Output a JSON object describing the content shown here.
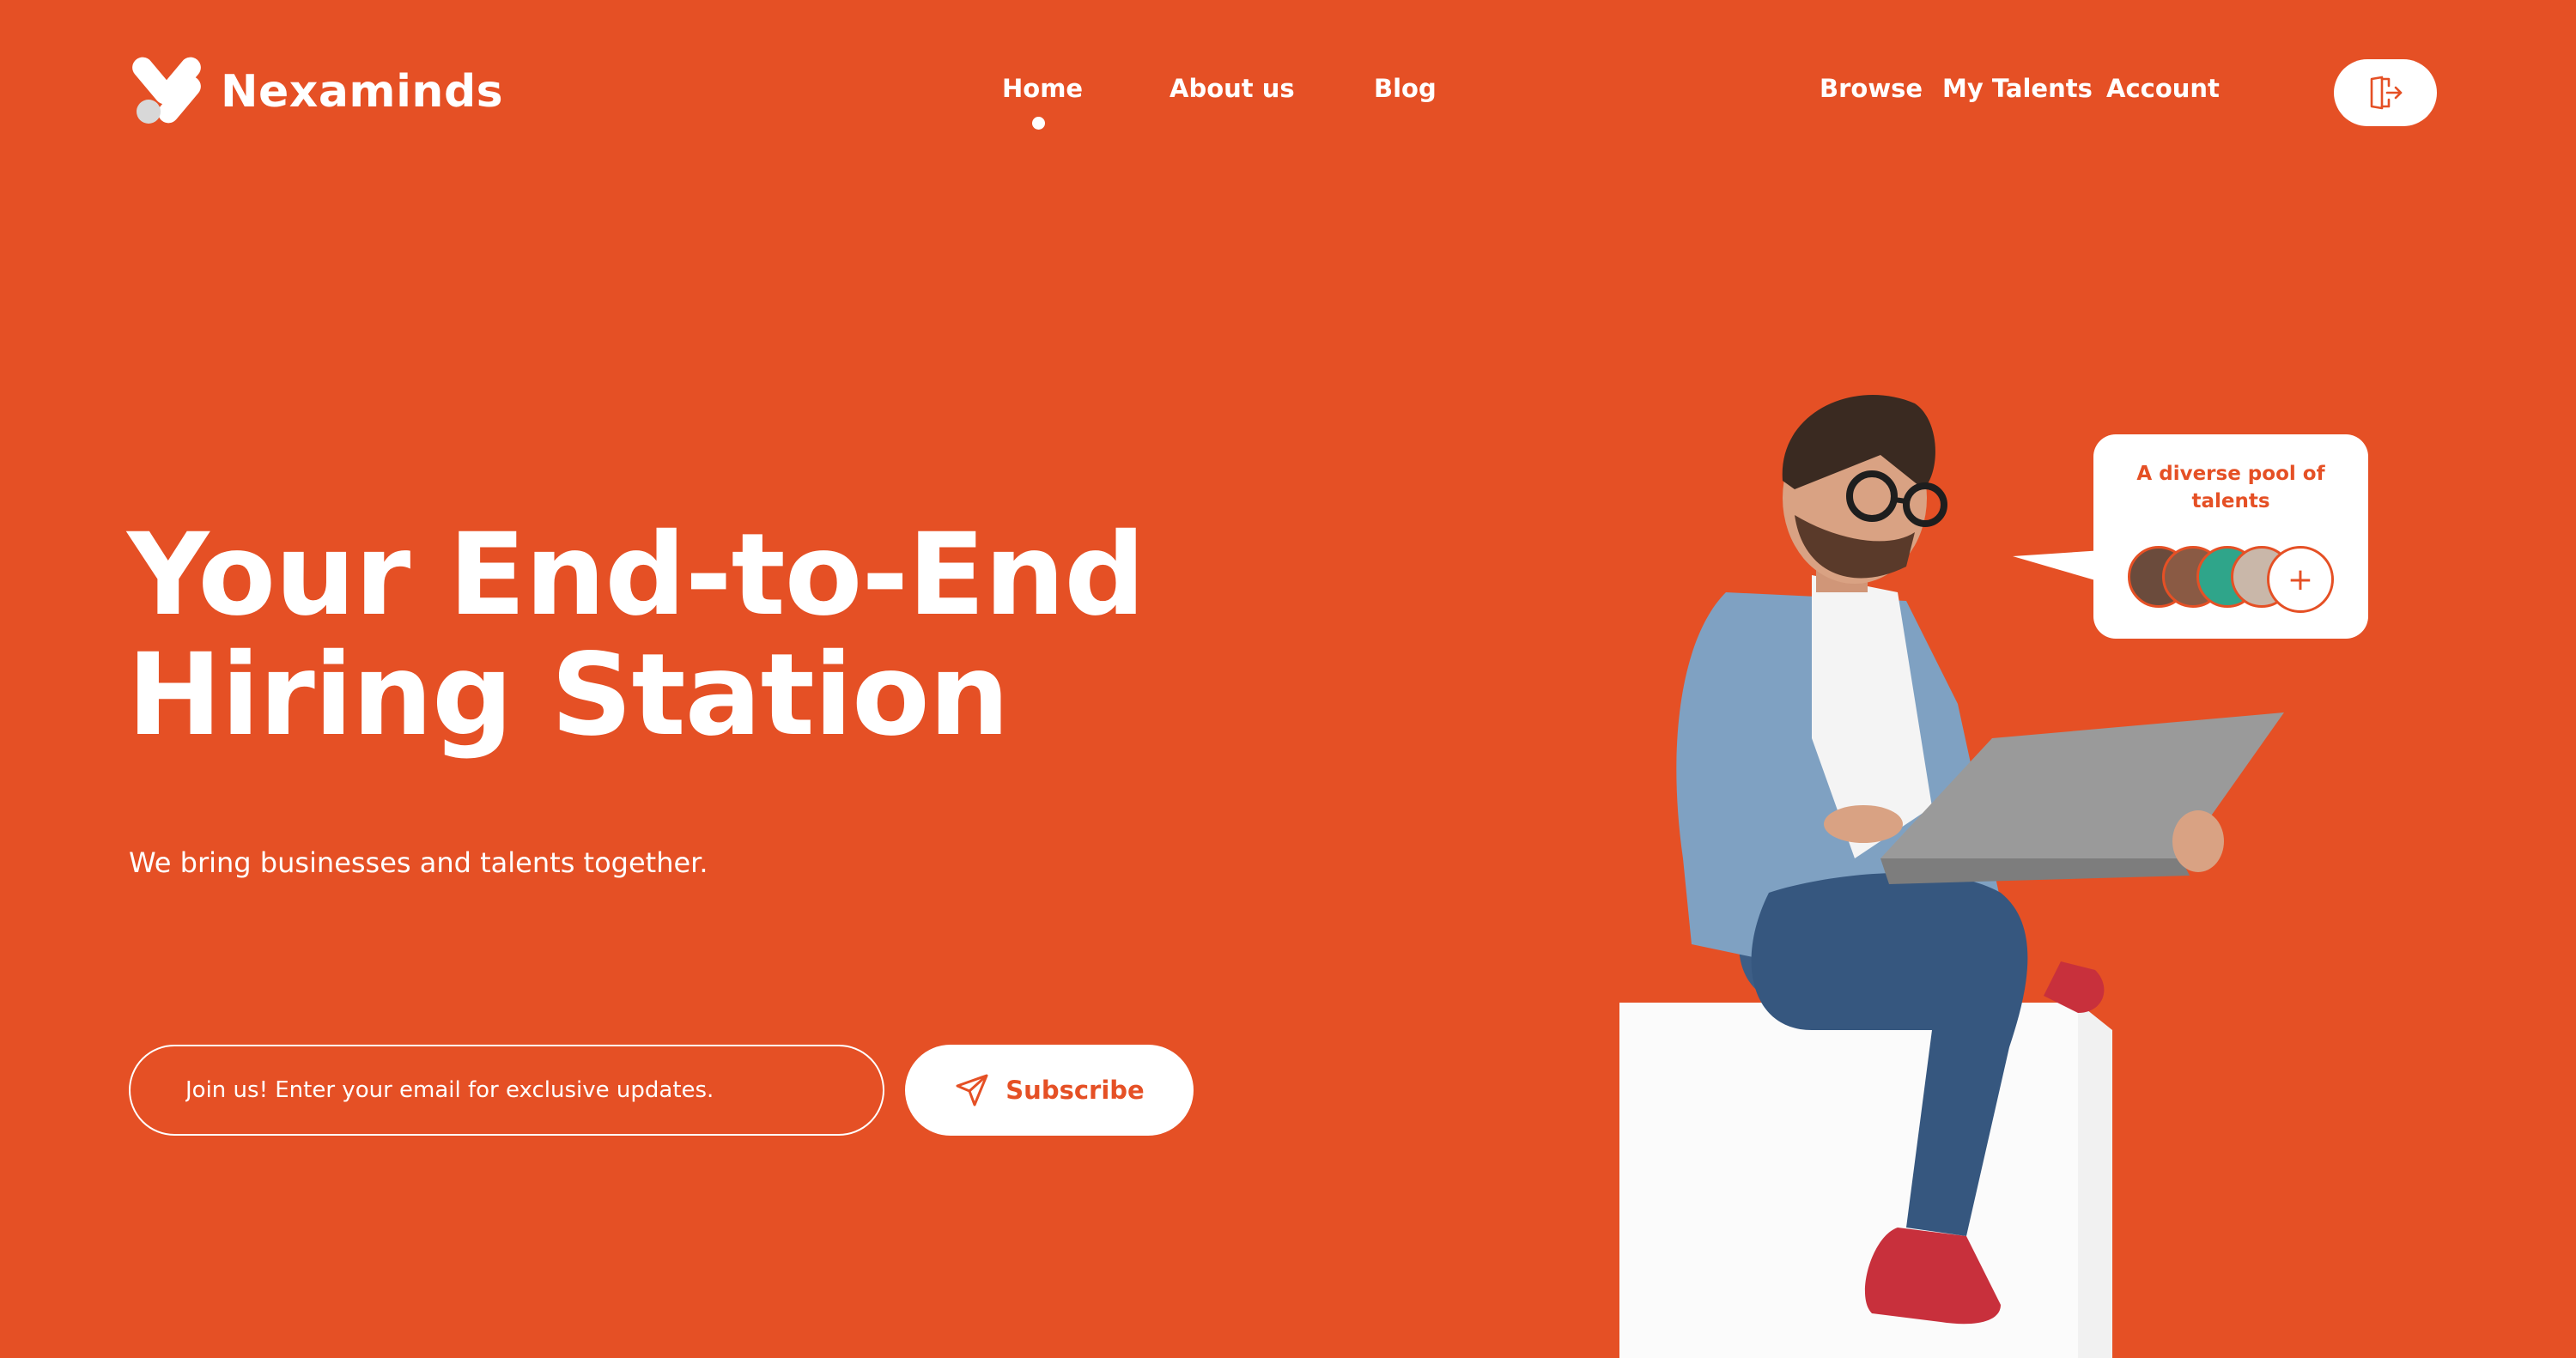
{
  "brand": {
    "name": "Nexaminds"
  },
  "nav": {
    "home": "Home",
    "about": "About us",
    "blog": "Blog",
    "browse": "Browse",
    "my_talents": "My Talents",
    "account": "Account"
  },
  "hero": {
    "title_line1": "Your End-to-End",
    "title_line2": "Hiring Station",
    "subtitle": "We bring businesses and talents together.",
    "email_placeholder": "Join us! Enter your email for exclusive updates.",
    "subscribe_label": "Subscribe"
  },
  "bubble": {
    "title": "A diverse pool of talents",
    "plus": "+"
  },
  "colors": {
    "accent": "#E55025",
    "white": "#FFFFFF"
  },
  "icons": {
    "logout": "logout-icon",
    "send": "send-icon"
  }
}
